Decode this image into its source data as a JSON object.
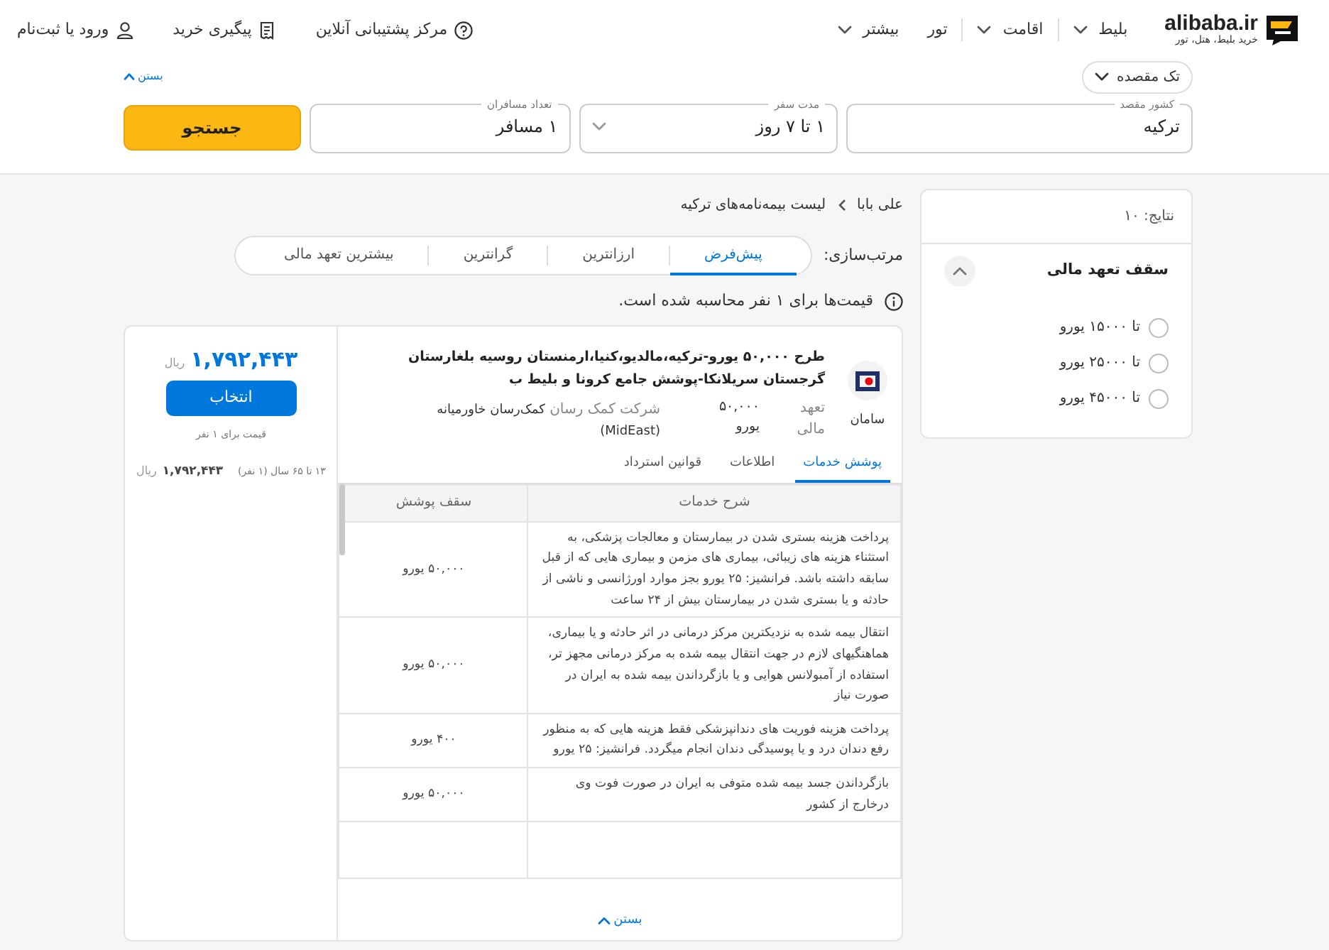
{
  "header": {
    "logo": {
      "name": "alibaba.ir",
      "tagline": "خرید بلیط، هتل، تور"
    },
    "nav": [
      {
        "label": "بلیط",
        "dropdown": true
      },
      {
        "label": "اقامت",
        "dropdown": true
      },
      {
        "label": "تور",
        "dropdown": false
      },
      {
        "label": "بیشتر",
        "dropdown": true
      }
    ],
    "actions": [
      {
        "label": "مرکز پشتیبانی آنلاین",
        "kind": "help"
      },
      {
        "label": "پیگیری خرید",
        "kind": "receipt"
      },
      {
        "label": "ورود یا ثبت‌نام",
        "kind": "user"
      }
    ]
  },
  "search": {
    "trip_type": "تک مقصده",
    "collapse_link": "بستن",
    "fields": [
      {
        "label": "کشور مقصد",
        "value": "ترکیه",
        "dropdown": false
      },
      {
        "label": "مدت سفر",
        "value": "۱ تا ۷ روز",
        "dropdown": true
      },
      {
        "label": "تعداد مسافران",
        "value": "۱ مسافر",
        "dropdown": false
      }
    ],
    "search_button": "جستجو"
  },
  "filters": {
    "results": "نتایج: ۱۰",
    "section": {
      "title": "سقف تعهد مالی",
      "expanded": true,
      "options": [
        {
          "label": "تا ۱۵۰۰۰ یورو",
          "selected": false
        },
        {
          "label": "تا ۲۵۰۰۰ یورو",
          "selected": false
        },
        {
          "label": "تا ۴۵۰۰۰ یورو",
          "selected": false
        }
      ]
    }
  },
  "breadcrumb": [
    "علی بابا",
    "لیست بیمه‌نامه‌های ترکیه"
  ],
  "sort": {
    "label": "مرتب‌سازی:",
    "options": [
      {
        "label": "پیش‌فرض",
        "selected": true
      },
      {
        "label": "ارزانترین",
        "selected": false
      },
      {
        "label": "گرانترین",
        "selected": false
      },
      {
        "label": "بیشترین تعهد مالی",
        "selected": false
      }
    ]
  },
  "notice": "قیمت‌ها برای ۱ نفر محاسبه شده است.",
  "results": [
    {
      "insurer": "سامان",
      "title": "طرح ۵۰,۰۰۰ یورو-ترکیه،مالدیو،کنیا،ارمنستان روسیه بلغارستان گرجستان سریلانکا-پوشش جامع کرونا و بلیط ب",
      "commitment_label": "تعهد مالی",
      "commitment_value": "۵۰,۰۰۰ یورو",
      "provider_label": "شرکت کمک رسان",
      "provider": "کمک‌رسان خاورمیانه (MidEast)",
      "tabs": [
        {
          "label": "پوشش خدمات",
          "selected": true
        },
        {
          "label": "اطلاعات",
          "selected": false
        },
        {
          "label": "قوانین استرداد",
          "selected": false
        }
      ],
      "table": {
        "columns": [
          "شرح خدمات",
          "سقف پوشش"
        ],
        "rows": [
          [
            "پرداخت هزینه بستری شدن در بیمارستان و معالجات پزشکی، به استثناء هزینه های زیبائی، بیماری های مزمن و بیماری هایی که از قبل سابقه داشته باشد. فرانشیز: ۲۵ یورو بجز موارد اورژانسی و ناشی از حادثه و یا بستری شدن در بیمارستان بیش از ۲۴ ساعت",
            "۵۰,۰۰۰ یورو"
          ],
          [
            "انتقال بیمه شده به نزدیکترین مرکز درمانی در اثر حادثه و یا بیماری، هماهنگیهای لازم در جهت انتقال بیمه شده به مرکز درمانی مجهز تر، استفاده از آمبولانس هوایی و یا بازگرداندن بیمه شده به ایران در صورت نیاز",
            "۵۰,۰۰۰ یورو"
          ],
          [
            "پرداخت هزینه فوریت های دندانپزشکی فقط هزینه هایی که به منظور رفع دندان درد و یا پوسیدگی دندان انجام میگردد. فرانشیز: ۲۵ یورو",
            "۴۰۰ یورو"
          ],
          [
            "بازگرداندن جسد بیمه شده متوفی به ایران در صورت فوت وی درخارج از کشور",
            "۵۰,۰۰۰ یورو"
          ]
        ]
      },
      "collapse_link": "بستن",
      "price": {
        "amount": "۱,۷۹۲,۴۴۳",
        "currency": "ریال",
        "button": "انتخاب",
        "note": "قیمت برای ۱ نفر",
        "breakdown_label": "۱۳ تا ۶۵ سال (۱ نفر)",
        "breakdown_amount": "۱,۷۹۲,۴۴۳",
        "breakdown_currency": "ریال"
      }
    }
  ]
}
